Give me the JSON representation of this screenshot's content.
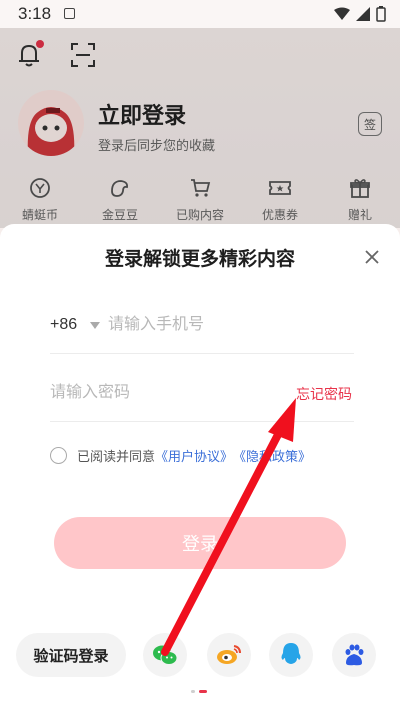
{
  "status_bar": {
    "time": "3:18"
  },
  "profile": {
    "login_title": "立即登录",
    "login_subtitle": "登录后同步您的收藏",
    "sign_label": "签",
    "menu": [
      {
        "label": "蜻蜓币",
        "icon": "coin-icon"
      },
      {
        "label": "金豆豆",
        "icon": "bean-icon"
      },
      {
        "label": "已购内容",
        "icon": "cart-icon"
      },
      {
        "label": "优惠券",
        "icon": "coupon-icon"
      },
      {
        "label": "赠礼",
        "icon": "gift-icon"
      }
    ]
  },
  "sheet": {
    "title": "登录解锁更多精彩内容",
    "country_code": "+86",
    "phone_placeholder": "请输入手机号",
    "password_placeholder": "请输入密码",
    "forgot_password": "忘记密码",
    "agree_prefix": "已阅读并同意",
    "user_agreement": "《用户协议》",
    "privacy_policy": "《隐私政策》",
    "login_button": "登录",
    "sms_login": "验证码登录",
    "social": [
      "wechat-icon",
      "weibo-icon",
      "qq-icon",
      "baidu-icon"
    ]
  },
  "colors": {
    "accent": "#e8334a",
    "login_button": "#ffc6c9",
    "link": "#3b6fd8",
    "annotation_arrow": "#f0101e"
  }
}
